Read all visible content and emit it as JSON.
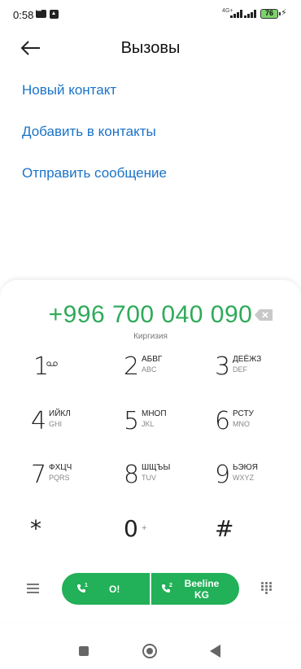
{
  "status_bar": {
    "time": "0:58",
    "network": "4G+",
    "battery": "76",
    "icons": [
      "message-icon",
      "upload-icon",
      "signal-icon",
      "signal-icon",
      "battery-icon",
      "charging-icon"
    ]
  },
  "header": {
    "title": "Вызовы"
  },
  "actions": [
    "Новый контакт",
    "Добавить в контакты",
    "Отправить сообщение"
  ],
  "dialer": {
    "number": "+996 700 040 090",
    "region": "Киргизия",
    "keys": [
      {
        "digit": "1",
        "l1": "",
        "l2": ""
      },
      {
        "digit": "2",
        "l1": "АБВГ",
        "l2": "ABC"
      },
      {
        "digit": "3",
        "l1": "ДЕЁЖЗ",
        "l2": "DEF"
      },
      {
        "digit": "4",
        "l1": "ИЙКЛ",
        "l2": "GHI"
      },
      {
        "digit": "5",
        "l1": "МНОП",
        "l2": "JKL"
      },
      {
        "digit": "6",
        "l1": "РСТУ",
        "l2": "MNO"
      },
      {
        "digit": "7",
        "l1": "ФХЦЧ",
        "l2": "PQRS"
      },
      {
        "digit": "8",
        "l1": "ШЩЪЫ",
        "l2": "TUV"
      },
      {
        "digit": "9",
        "l1": "ЬЭЮЯ",
        "l2": "WXYZ"
      }
    ],
    "star": "*",
    "zero": "0",
    "zero_sub": "+",
    "hash": "#"
  },
  "call_bar": {
    "sim1_number": "1",
    "sim1_name": "O!",
    "sim2_number": "2",
    "sim2_name_line1": "Beeline",
    "sim2_name_line2": "KG",
    "color": "#22b058"
  },
  "colors": {
    "accent_link": "#1a73c8",
    "number": "#2eaa58"
  }
}
